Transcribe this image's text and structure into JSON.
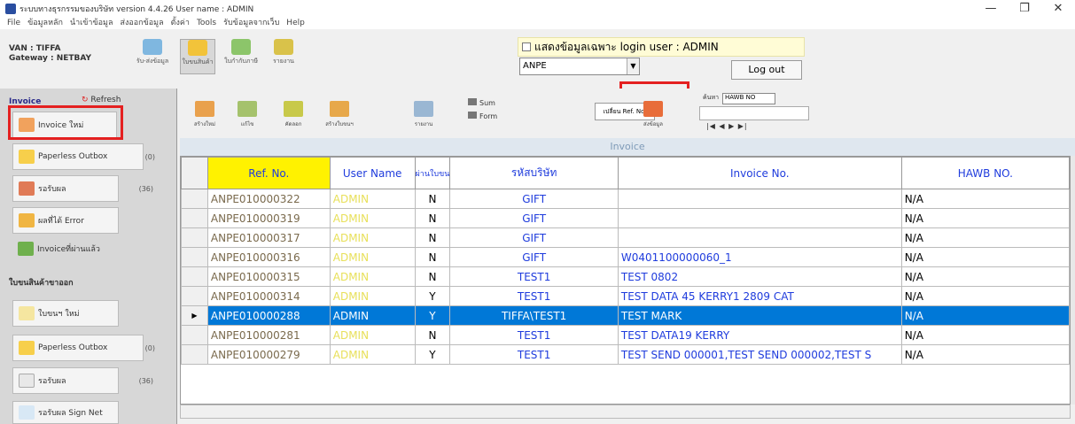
{
  "window": {
    "title": "ระบบทางธุรกรรมของบริษัท version 4.4.26 User name : ADMIN",
    "controls": [
      "—",
      "❐",
      "✕"
    ]
  },
  "menu": [
    "File",
    "ข้อมูลหลัก",
    "นำเข้าข้อมูล",
    "ส่งออกข้อมูล",
    "ตั้งค่า",
    "Tools",
    "รับข้อมูลจากเว็บ",
    "Help"
  ],
  "header": {
    "van_line": "VAN : TIFFA",
    "gateway_line": "Gateway : NETBAY",
    "toolbar": [
      "รับ-ส่งข้อมูล",
      "ใบขนสินค้า",
      "ใบกำกับภาษี",
      "รายงาน"
    ],
    "login_filter_label": "แสดงข้อมูลเฉพาะ login user : ADMIN",
    "company_value": "ANPE",
    "logout_label": "Log out"
  },
  "sidebar": {
    "invoice_title": "Invoice",
    "refresh_label": "Refresh",
    "invoice_items": [
      {
        "label": "Invoice ใหม่",
        "count": ""
      },
      {
        "label": "Paperless Outbox",
        "count": "(0)"
      },
      {
        "label": "รอรับผล",
        "count": "(36)"
      },
      {
        "label": "ผลที่ได้ Error",
        "count": ""
      },
      {
        "label": "Invoiceที่ผ่านแล้ว",
        "count": ""
      }
    ],
    "declaration_title": "ใบขนสินค้าขาออก",
    "declaration_items": [
      {
        "label": "ใบขนฯ ใหม่",
        "count": ""
      },
      {
        "label": "Paperless Outbox",
        "count": "(0)"
      },
      {
        "label": "รอรับผล",
        "count": "(36)"
      },
      {
        "label": "รอรับผล Sign Net",
        "count": ""
      }
    ]
  },
  "toolbar": {
    "buttons": [
      "สร้างใหม่",
      "แก้ไข",
      "คัดลอก",
      "สร้างใบขนฯ",
      "รายงาน"
    ],
    "sticker_lines": [
      "Sum",
      "Form"
    ],
    "refno_button": "เปลี่ยน Ref. No.",
    "send_button": "ส่งข้อมูล",
    "search_label": "ค้นหา",
    "search_field": "HAWB NO",
    "nav": "|◀ ◀ ▶ ▶|"
  },
  "grid": {
    "subtitle": "Invoice",
    "columns": [
      "Ref. No.",
      "User Name",
      "ผ่านใบขน",
      "รหัสบริษัท",
      "Invoice No.",
      "HAWB NO."
    ],
    "rows": [
      {
        "ref": "ANPE010000322",
        "user": "ADMIN",
        "flag": "N",
        "tax": "GIFT",
        "inv": "",
        "hawb": "N/A"
      },
      {
        "ref": "ANPE010000319",
        "user": "ADMIN",
        "flag": "N",
        "tax": "GIFT",
        "inv": "",
        "hawb": "N/A"
      },
      {
        "ref": "ANPE010000317",
        "user": "ADMIN",
        "flag": "N",
        "tax": "GIFT",
        "inv": "",
        "hawb": "N/A"
      },
      {
        "ref": "ANPE010000316",
        "user": "ADMIN",
        "flag": "N",
        "tax": "GIFT",
        "inv": "W0401100000060_1",
        "hawb": "N/A"
      },
      {
        "ref": "ANPE010000315",
        "user": "ADMIN",
        "flag": "N",
        "tax": "TEST1",
        "inv": "TEST 0802",
        "hawb": "N/A"
      },
      {
        "ref": "ANPE010000314",
        "user": "ADMIN",
        "flag": "Y",
        "tax": "TEST1",
        "inv": "TEST DATA 45 KERRY1 2809 CAT",
        "hawb": "N/A"
      },
      {
        "ref": "ANPE010000288",
        "user": "ADMIN",
        "flag": "Y",
        "tax": "TIFFA\\TEST1",
        "inv": "TEST MARK",
        "hawb": "N/A"
      },
      {
        "ref": "ANPE010000281",
        "user": "ADMIN",
        "flag": "N",
        "tax": "TEST1",
        "inv": "TEST DATA19 KERRY",
        "hawb": "N/A"
      },
      {
        "ref": "ANPE010000279",
        "user": "ADMIN",
        "flag": "Y",
        "tax": "TEST1",
        "inv": "TEST SEND 000001,TEST SEND 000002,TEST S",
        "hawb": "N/A"
      }
    ],
    "selected_row_marker": "▶"
  }
}
